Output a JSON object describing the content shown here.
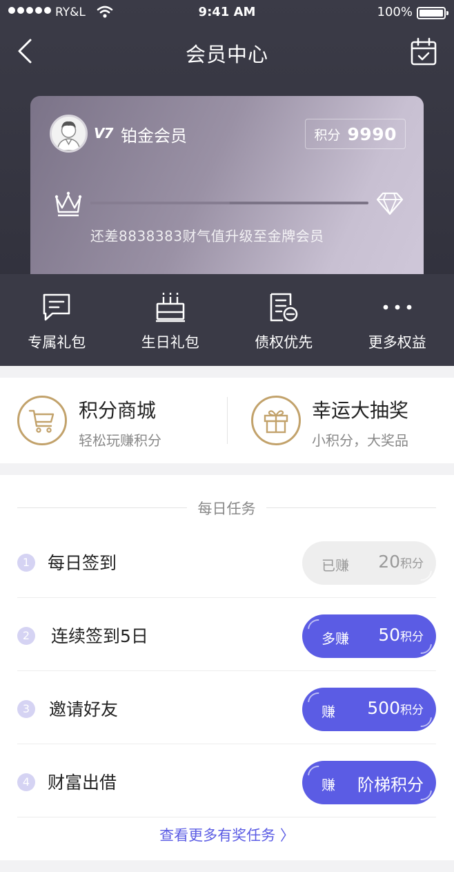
{
  "status_bar": {
    "carrier": "RY&L",
    "time": "9:41 AM",
    "battery": "100%"
  },
  "nav": {
    "title": "会员中心",
    "back_icon": "chevron-left-icon",
    "calendar_icon": "calendar-check-icon"
  },
  "card": {
    "level_badge": "V7",
    "level_name": "铂金会员",
    "points_label": "积分",
    "points_value": "9990",
    "progress": 0.5,
    "upgrade_text": "还差8838383财气值升级至金牌会员"
  },
  "benefits": [
    {
      "label": "专属礼包",
      "icon": "message-icon"
    },
    {
      "label": "生日礼包",
      "icon": "cake-icon"
    },
    {
      "label": "债权优先",
      "icon": "document-icon"
    },
    {
      "label": "更多权益",
      "icon": "more-icon"
    }
  ],
  "quick": [
    {
      "title": "积分商城",
      "sub": "轻松玩赚积分",
      "icon": "cart-icon"
    },
    {
      "title": "幸运大抽奖",
      "sub": "小积分，大奖品",
      "icon": "gift-icon"
    }
  ],
  "tasks": {
    "header": "每日任务",
    "items": [
      {
        "num": "1",
        "name": "每日签到",
        "action": "已赚",
        "amount": "20",
        "unit": "积分",
        "done": true
      },
      {
        "num": "2",
        "name": "连续签到5日",
        "action": "多赚",
        "amount": "50",
        "unit": "积分",
        "done": false
      },
      {
        "num": "3",
        "name": "邀请好友",
        "action": "赚",
        "amount": "500",
        "unit": "积分",
        "done": false
      },
      {
        "num": "4",
        "name": "财富出借",
        "action": "赚",
        "amount": "阶梯积分",
        "unit": "",
        "done": false
      }
    ],
    "more_link": "查看更多有奖任务 〉"
  },
  "colors": {
    "accent": "#5b5ce4",
    "gold": "#c2a26b",
    "header_bg": "#3a3a46"
  }
}
